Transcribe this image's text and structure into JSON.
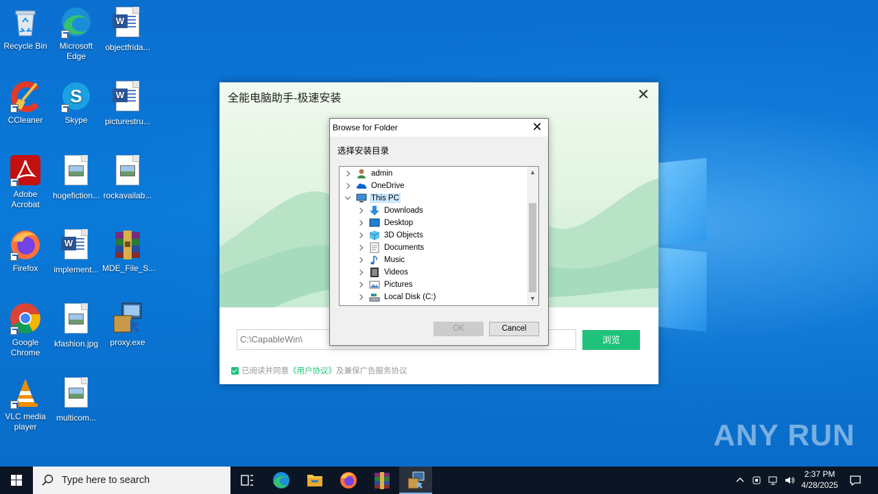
{
  "desktop_icons": [
    {
      "label": "Recycle Bin",
      "icon": "recycle-bin-icon"
    },
    {
      "label": "Microsoft Edge",
      "icon": "edge-icon"
    },
    {
      "label": "objectfrida...",
      "icon": "word-doc-icon"
    },
    {
      "label": "CCleaner",
      "icon": "ccleaner-icon"
    },
    {
      "label": "Skype",
      "icon": "skype-icon"
    },
    {
      "label": "picturestru...",
      "icon": "word-doc-icon"
    },
    {
      "label": "Adobe Acrobat",
      "icon": "acrobat-icon"
    },
    {
      "label": "hugefiction...",
      "icon": "image-file-icon"
    },
    {
      "label": "rockavailab...",
      "icon": "image-file-icon"
    },
    {
      "label": "Firefox",
      "icon": "firefox-icon"
    },
    {
      "label": "implement...",
      "icon": "word-doc-icon"
    },
    {
      "label": "MDE_File_S...",
      "icon": "winrar-icon"
    },
    {
      "label": "Google Chrome",
      "icon": "chrome-icon"
    },
    {
      "label": "kfashion.jpg",
      "icon": "image-file-icon"
    },
    {
      "label": "proxy.exe",
      "icon": "installer-icon"
    },
    {
      "label": "VLC media player",
      "icon": "vlc-icon"
    },
    {
      "label": "multicom...",
      "icon": "image-file-icon"
    }
  ],
  "installer": {
    "title": "全能电脑助手-极速安装",
    "path_value": "C:\\CapableWin\\",
    "browse_label": "浏览",
    "agree_prefix": "已阅读并同意",
    "agree_link": "《用户协议》",
    "agree_suffix": "及兼保广告服务协议",
    "accent": "#1fc27a"
  },
  "browse_dialog": {
    "title": "Browse for Folder",
    "prompt": "选择安装目录",
    "tree": [
      {
        "label": "admin",
        "icon": "user-folder-icon",
        "level": 0,
        "expanded": false
      },
      {
        "label": "OneDrive",
        "icon": "onedrive-icon",
        "level": 0,
        "expanded": false
      },
      {
        "label": "This PC",
        "icon": "this-pc-icon",
        "level": 0,
        "expanded": true,
        "selected": true
      },
      {
        "label": "Downloads",
        "icon": "downloads-icon",
        "level": 1,
        "expanded": false
      },
      {
        "label": "Desktop",
        "icon": "desktop-folder-icon",
        "level": 1,
        "expanded": false
      },
      {
        "label": "3D Objects",
        "icon": "3d-objects-icon",
        "level": 1,
        "expanded": false
      },
      {
        "label": "Documents",
        "icon": "documents-icon",
        "level": 1,
        "expanded": false
      },
      {
        "label": "Music",
        "icon": "music-icon",
        "level": 1,
        "expanded": false
      },
      {
        "label": "Videos",
        "icon": "videos-icon",
        "level": 1,
        "expanded": false
      },
      {
        "label": "Pictures",
        "icon": "pictures-icon",
        "level": 1,
        "expanded": false
      },
      {
        "label": "Local Disk (C:)",
        "icon": "local-disk-icon",
        "level": 1,
        "expanded": false
      }
    ],
    "ok_label": "OK",
    "cancel_label": "Cancel"
  },
  "watermark": "ANY RUN",
  "taskbar": {
    "search_placeholder": "Type here to search",
    "pinned": [
      "task-view",
      "edge",
      "file-explorer",
      "firefox",
      "winrar",
      "installer"
    ],
    "time": "2:37 PM",
    "date": "4/28/2025"
  }
}
